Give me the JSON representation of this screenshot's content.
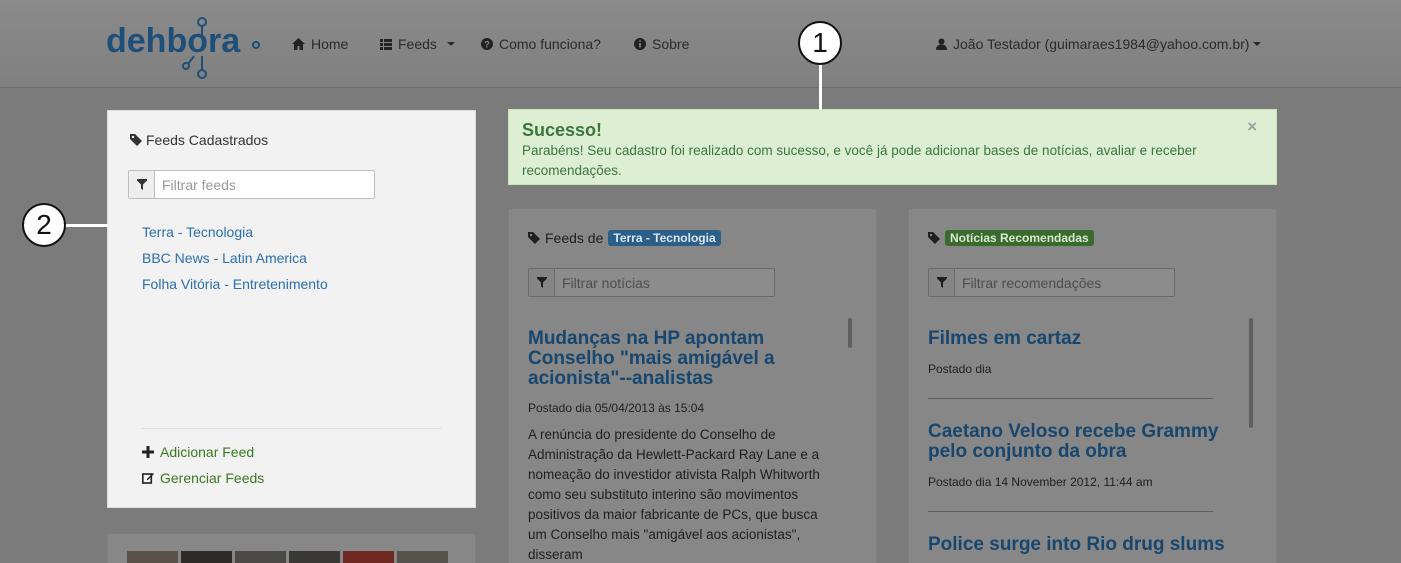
{
  "navbar": {
    "logo_text": "dehbora",
    "items": [
      {
        "label": "Home",
        "icon": "home-icon"
      },
      {
        "label": "Feeds",
        "icon": "list-icon"
      },
      {
        "label": "Como funciona?",
        "icon": "question-icon"
      },
      {
        "label": "Sobre",
        "icon": "info-icon"
      }
    ],
    "user": "João Testador (guimaraes1984@yahoo.com.br)"
  },
  "callouts": [
    "1",
    "2"
  ],
  "sidebar": {
    "title": "Feeds Cadastrados",
    "filter_placeholder": "Filtrar feeds",
    "feeds": [
      "Terra - Tecnologia",
      "BBC News - Latin America",
      "Folha Vitória - Entretenimento"
    ],
    "actions": [
      "Adicionar Feed",
      "Gerenciar Feeds"
    ]
  },
  "alert": {
    "heading": "Sucesso!",
    "message": "Parabéns! Seu cadastro foi realizado com sucesso, e você já pode adicionar bases de notícias, avaliar e receber recomendações.",
    "close": "×"
  },
  "feeds_panel": {
    "title_prefix": "Feeds de",
    "badge": "Terra - Tecnologia",
    "filter_placeholder": "Filtrar notícias",
    "article": {
      "title": "Mudanças na HP apontam Conselho \"mais amigável a acionista\"--analistas",
      "meta": "Postado dia 05/04/2013 às 15:04",
      "body": "A renúncia do presidente do Conselho de Administração da Hewlett-Packard Ray Lane e a nomeação do investidor ativista Ralph Whitworth como seu substituto interino são movimentos positivos da maior fabricante de PCs, que busca um Conselho mais \"amigável aos acionistas\", disseram"
    }
  },
  "recs_panel": {
    "badge": "Notícias Recomendadas",
    "filter_placeholder": "Filtrar recomendações",
    "items": [
      {
        "title": "Filmes em cartaz",
        "meta": "Postado dia"
      },
      {
        "title": "Caetano Veloso recebe Grammy pelo conjunto da obra",
        "meta": "Postado dia 14 November 2012, 11:44 am"
      },
      {
        "title": "Police surge into Rio drug slums",
        "meta": ""
      }
    ]
  },
  "colors": {
    "link": "#2a6fb0",
    "success_bg": "#dcefd2",
    "success_text": "#3c763d",
    "overlay": "#7b7b7b"
  }
}
